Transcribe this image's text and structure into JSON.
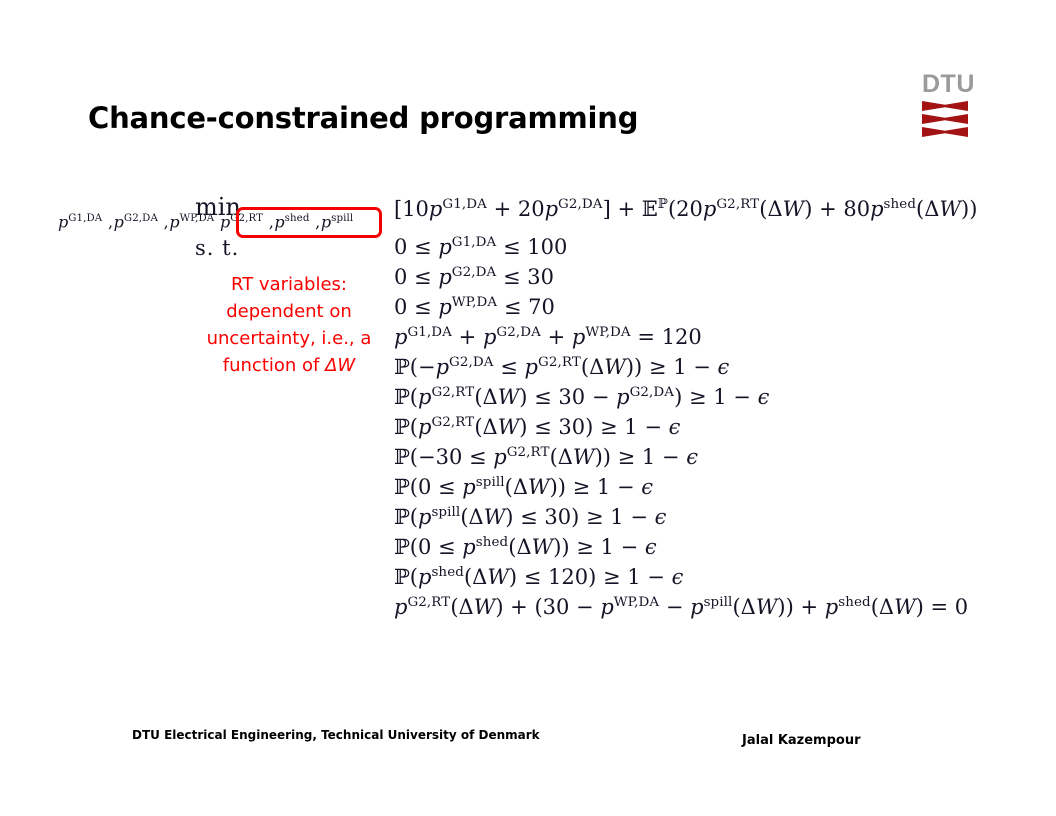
{
  "slide": {
    "title": "Chance-constrained programming",
    "background_color": "#ffffff"
  },
  "logo": {
    "text": "DTU",
    "text_color": "#9a9a9a",
    "mark_color": "#a31313",
    "mark_count": 3
  },
  "optimization": {
    "min_label": "min",
    "min_subscript_prefix": "p",
    "subscript_vars_da": [
      {
        "base": "p",
        "sup": "G1,DA"
      },
      {
        "base": "p",
        "sup": "G2,DA"
      },
      {
        "base": "p",
        "sup": "WP,DA"
      }
    ],
    "subscript_vars_rt": [
      {
        "base": "p",
        "sup": "G2,RT"
      },
      {
        "base": "p",
        "sup": "shed"
      },
      {
        "base": "p",
        "sup": "spill"
      }
    ],
    "subject_to_label": "s. t.",
    "highlight_box_color": "#f40000"
  },
  "annotation": {
    "color": "#fc0000",
    "line1": "RT variables:",
    "line2": "dependent on",
    "line3": "uncertainty, i.e., a",
    "line4_prefix": "function of ",
    "line4_symbol": "ΔW"
  },
  "equations": {
    "objective": {
      "open_bracket": "[",
      "coef1": "10",
      "var1_base": "p",
      "var1_sup": "G1,DA",
      "plus1": " + ",
      "coef2": "20",
      "var2_base": "p",
      "var2_sup": "G2,DA",
      "close_bracket": "]",
      "plus2": " + ",
      "expectation": "𝔼",
      "expectation_sup": "ℙ",
      "open_paren": "(",
      "coef3": "20",
      "var3_base": "p",
      "var3_sup": "G2,RT",
      "arg1": "(ΔW)",
      "plus3": " + ",
      "coef4": "80",
      "var4_base": "p",
      "var4_sup": "shed",
      "arg2": "(ΔW)",
      "close_paren": ")",
      "plain": "[10p^{G1,DA} + 20p^{G2,DA}] + E^P(20p^{G2,RT}(ΔW) + 80p^{shed}(ΔW))"
    },
    "constraints": [
      {
        "id": "bound-g1-da",
        "plain": "0 ≤ p^{G1,DA} ≤ 100",
        "lhs": "0 ≤ ",
        "var_base": "p",
        "var_sup": "G1,DA",
        "rhs": " ≤ 100"
      },
      {
        "id": "bound-g2-da",
        "plain": "0 ≤ p^{G2,DA} ≤ 30",
        "lhs": "0 ≤ ",
        "var_base": "p",
        "var_sup": "G2,DA",
        "rhs": " ≤ 30"
      },
      {
        "id": "bound-wp-da",
        "plain": "0 ≤ p^{WP,DA} ≤ 70",
        "lhs": "0 ≤ ",
        "var_base": "p",
        "var_sup": "WP,DA",
        "rhs": " ≤ 70"
      },
      {
        "id": "power-balance-da",
        "plain": "p^{G1,DA} + p^{G2,DA} + p^{WP,DA} = 120",
        "total": "120"
      },
      {
        "id": "cc-g2rt-lower-by-da",
        "plain": "ℙ(−p^{G2,DA} ≤ p^{G2,RT}(ΔW)) ≥ 1 − ϵ"
      },
      {
        "id": "cc-g2rt-upper-by-da",
        "plain": "ℙ(p^{G2,RT}(ΔW) ≤ 30 − p^{G2,DA}) ≥ 1 − ϵ"
      },
      {
        "id": "cc-g2rt-upper-30",
        "plain": "ℙ(p^{G2,RT}(ΔW) ≤ 30) ≥ 1 − ϵ"
      },
      {
        "id": "cc-g2rt-lower-30",
        "plain": "ℙ(−30 ≤ p^{G2,RT}(ΔW)) ≥ 1 − ϵ"
      },
      {
        "id": "cc-spill-lower-0",
        "plain": "ℙ(0 ≤ p^{spill}(ΔW)) ≥ 1 − ϵ"
      },
      {
        "id": "cc-spill-upper-30",
        "plain": "ℙ(p^{spill}(ΔW) ≤ 30) ≥ 1 − ϵ"
      },
      {
        "id": "cc-shed-lower-0",
        "plain": "ℙ(0 ≤ p^{shed}(ΔW)) ≥ 1 − ϵ"
      },
      {
        "id": "cc-shed-upper-120",
        "plain": "ℙ(p^{shed}(ΔW) ≤ 120) ≥ 1 − ϵ"
      },
      {
        "id": "power-balance-rt",
        "plain": "p^{G2,RT}(ΔW) + (30 − p^{WP,DA} − p^{spill}(ΔW)) + p^{shed}(ΔW) = 0"
      }
    ]
  },
  "footer": {
    "left": "DTU Electrical Engineering, Technical University of Denmark",
    "right": "Jalal Kazempour"
  }
}
